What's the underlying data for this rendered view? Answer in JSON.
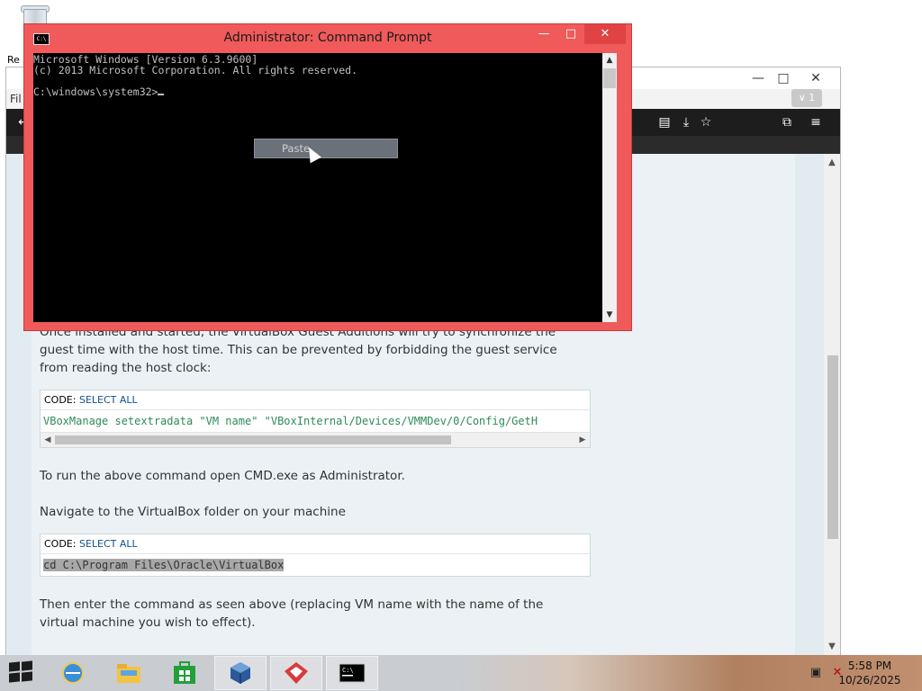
{
  "desktop": {
    "recycle_label": "Re",
    "browser_menu_label": "Fil"
  },
  "browser": {
    "minimize": "—",
    "maximize": "□",
    "close": "✕",
    "tab_count": "∨ 1",
    "toolbar_icons": [
      "reader-icon",
      "download-icon",
      "star-icon",
      "extensions-icon",
      "menu-icon"
    ]
  },
  "page": {
    "intro": "Once installed and started, the VirtualBox Guest Additions will try to synchronize the guest time with the host time. This can be prevented by forbidding the guest service from reading the host clock:",
    "code1": {
      "label": "CODE: ",
      "select_all": "SELECT ALL",
      "line": "VBoxManage setextradata \"VM name\" \"VBoxInternal/Devices/VMMDev/0/Config/GetH"
    },
    "p2": "To run the above command open CMD.exe as Administrator.",
    "p3": "Navigate to the VirtualBox folder on your machine",
    "code2": {
      "label": "CODE: ",
      "select_all": "SELECT ALL",
      "line": "cd C:\\Program Files\\Oracle\\VirtualBox"
    },
    "p4": "Then enter the command as seen above (replacing VM name with the name of the virtual machine you wish to effect)."
  },
  "cmd": {
    "title": "Administrator: Command Prompt",
    "icon_text": "C:\\",
    "line1": "Microsoft Windows [Version 6.3.9600]",
    "line2": "(c) 2013 Microsoft Corporation. All rights reserved.",
    "prompt": "C:\\windows\\system32>",
    "context_menu_item": "Paste",
    "minimize": "—",
    "maximize": "□",
    "close": "✕"
  },
  "taskbar": {
    "time": "5:58 PM",
    "date": "10/26/2025",
    "apps": [
      "internet-explorer",
      "file-explorer",
      "windows-store",
      "virtualbox",
      "gns3",
      "command-prompt"
    ]
  },
  "colors": {
    "cmd_frame": "#f05a5a",
    "code_green": "#2e8b57",
    "select_all_blue": "#105289",
    "page_bg": "#ebf1f5"
  }
}
